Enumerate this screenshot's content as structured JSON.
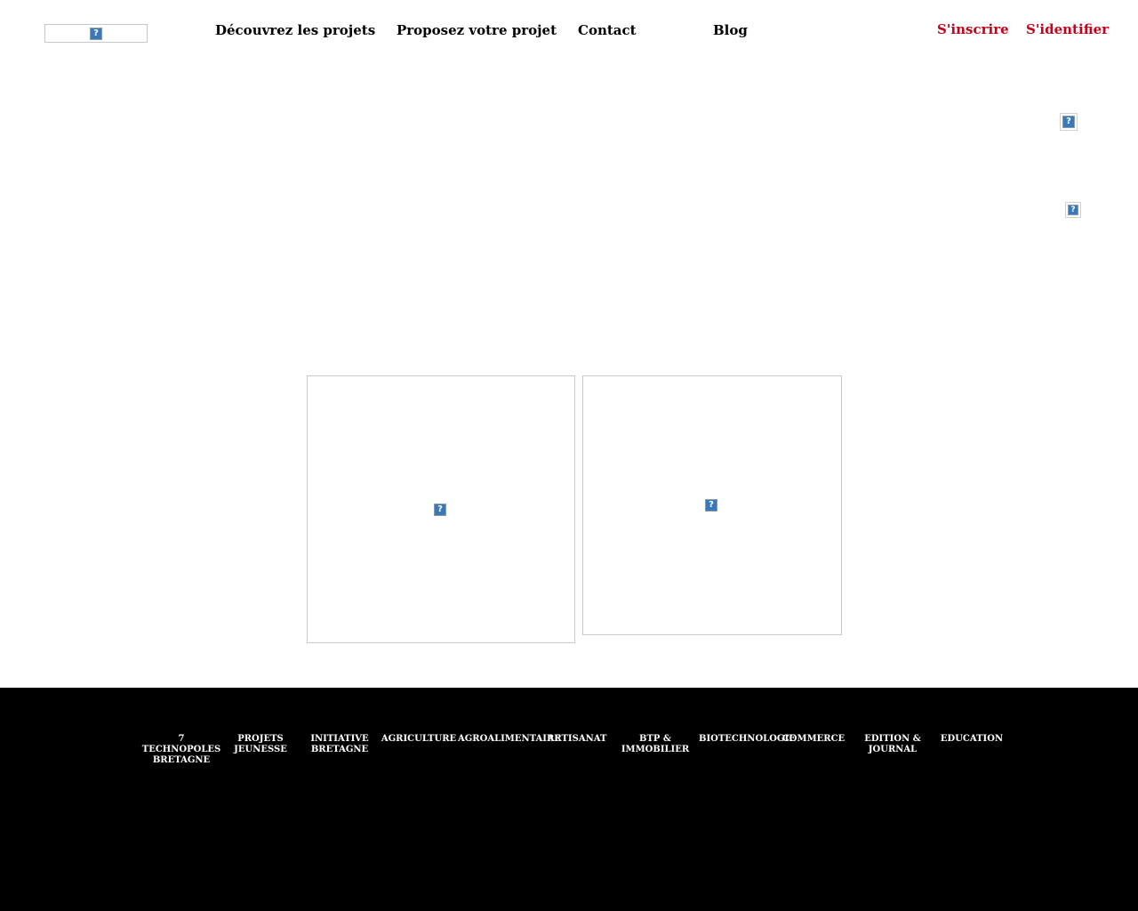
{
  "header": {
    "logo_icon": "broken-image-icon",
    "nav": [
      {
        "label": "Découvrez les projets"
      },
      {
        "label": "Proposez votre projet"
      },
      {
        "label": "Contact"
      },
      {
        "label": "Blog"
      }
    ],
    "signup_label": "S'inscrire",
    "login_label": "S'identifier",
    "accent_color": "#c4001a"
  },
  "main": {
    "side_icons": [
      "broken-image-icon",
      "broken-image-icon"
    ],
    "cards": [
      {
        "icon": "broken-image-icon"
      },
      {
        "icon": "broken-image-icon"
      }
    ]
  },
  "footer": {
    "background": "#000000",
    "categories": [
      {
        "label": "7 TECHNOPOLES BRETAGNE"
      },
      {
        "label": "PROJETS JEUNESSE"
      },
      {
        "label": "INITIATIVE BRETAGNE"
      },
      {
        "label": "AGRICULTURE"
      },
      {
        "label": "AGROALIMENTAIRE"
      },
      {
        "label": "ARTISANAT"
      },
      {
        "label": "BTP & IMMOBILIER"
      },
      {
        "label": "BIOTECHNOLOGIE"
      },
      {
        "label": "COMMERCE"
      },
      {
        "label": "EDITION & JOURNAL"
      },
      {
        "label": "EDUCATION"
      }
    ]
  }
}
